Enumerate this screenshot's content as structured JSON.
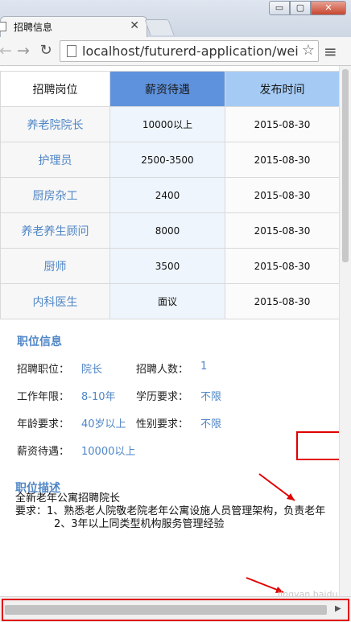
{
  "browser": {
    "tab_title": "招聘信息",
    "url": "localhost/futurerd-application/weix",
    "window_controls": [
      "▭",
      "▢",
      "✕"
    ],
    "icons": [
      "back-icon",
      "forward-icon",
      "reload-icon",
      "page-icon",
      "star-icon",
      "menu-icon",
      "close-icon"
    ]
  },
  "table": {
    "headers": [
      "招聘岗位",
      "薪资待遇",
      "发布时间"
    ],
    "rows": [
      {
        "position": "养老院院长",
        "salary": "10000以上",
        "date": "2015-08-30"
      },
      {
        "position": "护理员",
        "salary": "2500-3500",
        "date": "2015-08-30"
      },
      {
        "position": "厨房杂工",
        "salary": "2400",
        "date": "2015-08-30"
      },
      {
        "position": "养老养生顾问",
        "salary": "8000",
        "date": "2015-08-30"
      },
      {
        "position": "厨师",
        "salary": "3500",
        "date": "2015-08-30"
      },
      {
        "position": "内科医生",
        "salary": "面议",
        "date": "2015-08-30"
      }
    ]
  },
  "job_info": {
    "title": "职位信息",
    "position_label": "招聘职位：",
    "position_value": "院长",
    "count_label": "招聘人数：",
    "count_value": "1",
    "years_label": "工作年限：",
    "years_value": "8-10年",
    "edu_label": "学历要求：",
    "edu_value": "不限",
    "age_label": "年龄要求：",
    "age_value": "40岁以上",
    "gender_label": "性别要求：",
    "gender_value": "不限",
    "salary_label": "薪资待遇：",
    "salary_value": "10000以上"
  },
  "job_desc": {
    "title": "职位描述",
    "line1": "全新老年公寓招聘院长",
    "line2": "要求：1、熟悉老人院敬老院老年公寓设施人员管理架构，负责老年",
    "line3": "2、3年以上同类型机构服务管理经验"
  },
  "watermark": "jingyan.baidu.com",
  "colors": {
    "accent": "#4f86c6",
    "header_mid": "#5f92dc",
    "header_right": "#a5cbf5",
    "annotation": "#e00000"
  }
}
